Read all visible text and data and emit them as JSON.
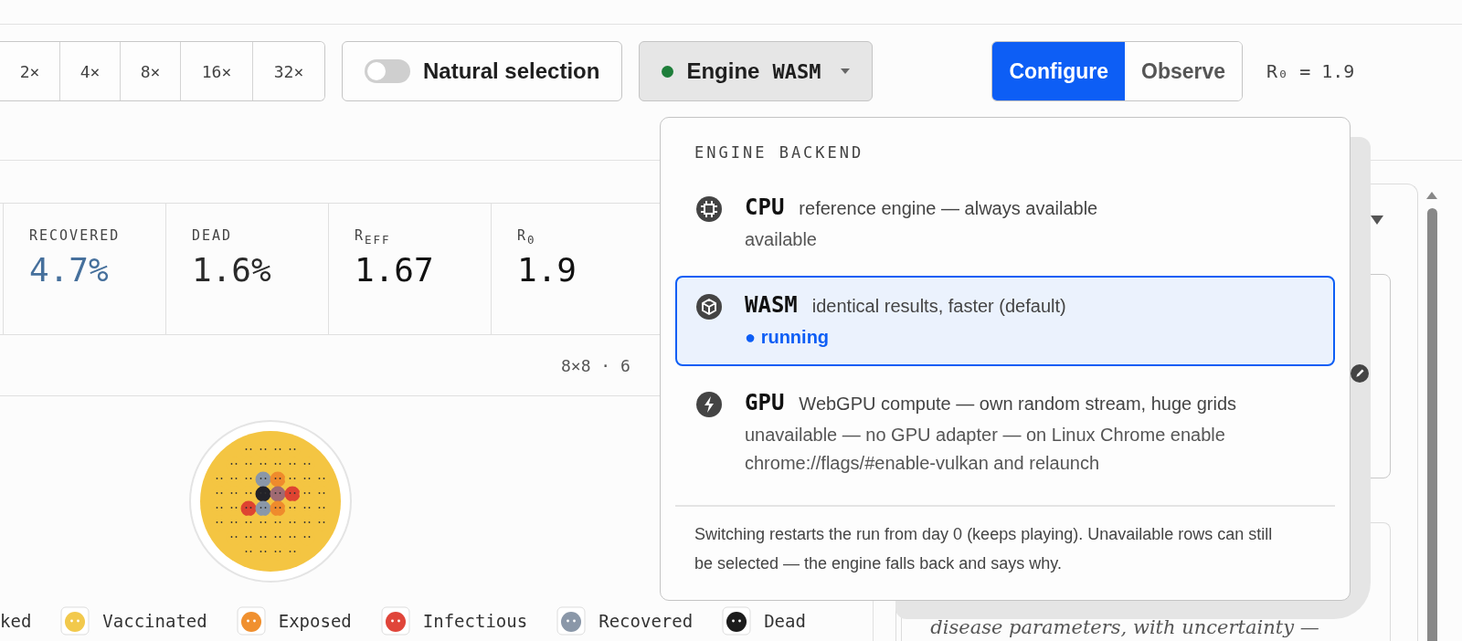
{
  "toolbar": {
    "speeds": [
      {
        "label": "2×",
        "selected": false
      },
      {
        "label": "4×",
        "selected": false
      },
      {
        "label": "8×",
        "selected": false
      },
      {
        "label": "16×",
        "selected": false
      },
      {
        "label": "32×",
        "selected": false
      }
    ],
    "natural_selection": {
      "label": "Natural selection",
      "on": false
    },
    "engine": {
      "label": "Engine",
      "value": "WASM",
      "running": true
    },
    "modes": [
      {
        "label": "Configure",
        "selected": true
      },
      {
        "label": "Observe",
        "selected": false
      }
    ],
    "r0_readout": "R₀ = 1.9"
  },
  "stats": [
    {
      "label": "RECOVERED",
      "value": "4.7%",
      "color": "#46709c"
    },
    {
      "label": "DEAD",
      "value": "1.6%",
      "color": "#2a2a2a"
    },
    {
      "label": "R$_{EFF}$",
      "value": "1.67",
      "color": "#111111"
    },
    {
      "label": "R$_{0}$",
      "value": "1.9",
      "color": "#111111"
    }
  ],
  "grid_info": "8×8 · 6",
  "legend": [
    {
      "label": "ked"
    },
    {
      "label": "Vaccinated",
      "color": "#f2c94c"
    },
    {
      "label": "Exposed",
      "color": "#f0902f"
    },
    {
      "label": "Infectious",
      "color": "#e0453a"
    },
    {
      "label": "Recovered",
      "color": "#8a97a8"
    },
    {
      "label": "Dead",
      "color": "#1c1c1c"
    }
  ],
  "engine_menu": {
    "title": "ENGINE BACKEND",
    "options": [
      {
        "name": "CPU",
        "description": "reference engine — always available",
        "status": "available",
        "running": false,
        "selected": false,
        "kind": "chip"
      },
      {
        "name": "WASM",
        "description": "identical results, faster (default)",
        "status": "● running",
        "running": true,
        "selected": true,
        "kind": "cube"
      },
      {
        "name": "GPU",
        "description": "WebGPU compute — own random stream, huge grids",
        "status": "unavailable — no GPU adapter — on Linux Chrome enable chrome://flags/#enable-vulkan and relaunch",
        "running": false,
        "selected": false,
        "kind": "bolt"
      }
    ],
    "note": "Switching restarts the run from day 0 (keeps playing). Unavailable rows can still be selected — the engine falls back and says why."
  },
  "side_panel": {
    "text": "disease parameters, with uncertainty —"
  }
}
